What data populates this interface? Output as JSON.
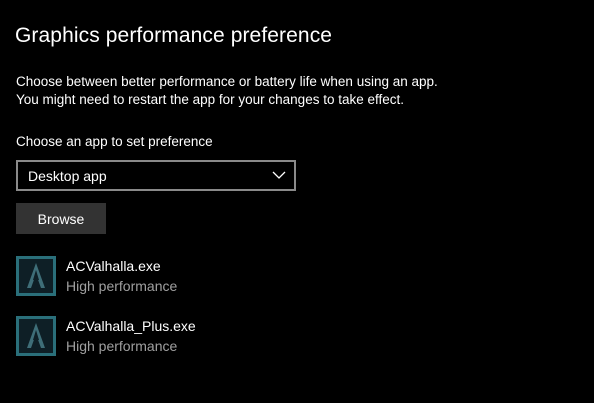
{
  "page": {
    "title": "Graphics performance preference",
    "description_lines": [
      "Choose between better performance or battery life when using an app.",
      "You might need to restart the app for your changes to take effect."
    ],
    "choose_label": "Choose an app to set preference"
  },
  "app_type_select": {
    "selected": "Desktop app",
    "icon": "chevron-down-icon"
  },
  "browse_button": {
    "label": "Browse"
  },
  "apps": [
    {
      "name": "ACValhalla.exe",
      "preference": "High performance",
      "icon": "assassins-creed-app-icon"
    },
    {
      "name": "ACValhalla_Plus.exe",
      "preference": "High performance",
      "icon": "assassins-creed-app-icon"
    }
  ],
  "colors": {
    "background": "#000000",
    "text": "#ffffff",
    "secondary_text": "#a0a0a0",
    "button_bg": "#333333",
    "dropdown_border": "#8a8a8a",
    "app_icon_frame": "#2a6f7a"
  }
}
